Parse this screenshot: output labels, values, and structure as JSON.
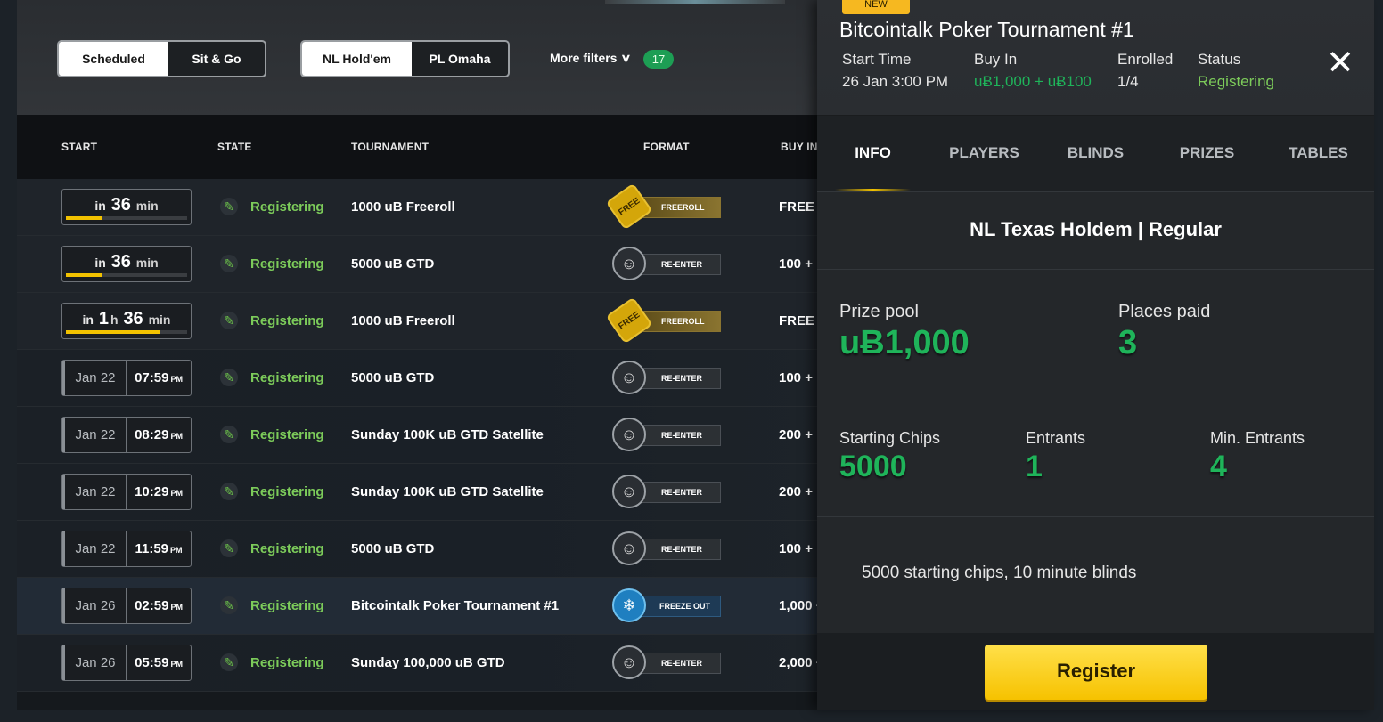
{
  "lobby": {
    "tabs_type": [
      "Scheduled",
      "Sit & Go"
    ],
    "tabs_game": [
      "NL Hold'em",
      "PL Omaha"
    ],
    "more_filters": "More filters",
    "filter_count": "17",
    "columns": {
      "start": "START",
      "state": "STATE",
      "tournament": "TOURNAMENT",
      "format": "FORMAT",
      "buyin": "BUY IN"
    },
    "rows": [
      {
        "kind": "countdown",
        "prefix": "in",
        "h": "",
        "h_unit": "",
        "m": "36",
        "m_unit": "min",
        "progress": 0.3,
        "state": "Registering",
        "name": "1000 uB Freeroll",
        "format": "FREEROLL",
        "format_icon": "free-tag-icon",
        "buyin": "FREE"
      },
      {
        "kind": "countdown",
        "prefix": "in",
        "h": "",
        "h_unit": "",
        "m": "36",
        "m_unit": "min",
        "progress": 0.3,
        "state": "Registering",
        "name": "5000 uB GTD",
        "format": "RE-ENTER",
        "format_icon": "re-enter-icon",
        "buyin": "100 +"
      },
      {
        "kind": "countdown",
        "prefix": "in",
        "h": "1",
        "h_unit": "h",
        "m": "36",
        "m_unit": "min",
        "progress": 0.78,
        "state": "Registering",
        "name": "1000 uB Freeroll",
        "format": "FREEROLL",
        "format_icon": "free-tag-icon",
        "buyin": "FREE"
      },
      {
        "kind": "date",
        "date": "Jan 22",
        "time": "07:59",
        "ampm": "PM",
        "state": "Registering",
        "name": "5000 uB GTD",
        "format": "RE-ENTER",
        "format_icon": "re-enter-icon",
        "buyin": "100 +"
      },
      {
        "kind": "date",
        "date": "Jan 22",
        "time": "08:29",
        "ampm": "PM",
        "state": "Registering",
        "name": "Sunday 100K uB GTD Satellite",
        "format": "RE-ENTER",
        "format_icon": "re-enter-icon",
        "buyin": "200 +"
      },
      {
        "kind": "date",
        "date": "Jan 22",
        "time": "10:29",
        "ampm": "PM",
        "state": "Registering",
        "name": "Sunday 100K uB GTD Satellite",
        "format": "RE-ENTER",
        "format_icon": "re-enter-icon",
        "buyin": "200 +"
      },
      {
        "kind": "date",
        "date": "Jan 22",
        "time": "11:59",
        "ampm": "PM",
        "state": "Registering",
        "name": "5000 uB GTD",
        "format": "RE-ENTER",
        "format_icon": "re-enter-icon",
        "buyin": "100 +"
      },
      {
        "kind": "date",
        "date": "Jan 26",
        "time": "02:59",
        "ampm": "PM",
        "state": "Registering",
        "name": "Bitcointalk Poker Tournament #1",
        "format": "FREEZE OUT",
        "format_icon": "snowflake-icon",
        "buyin": "1,000 +",
        "highlight": true
      },
      {
        "kind": "date",
        "date": "Jan 26",
        "time": "05:59",
        "ampm": "PM",
        "state": "Registering",
        "name": "Sunday 100,000 uB GTD",
        "format": "RE-ENTER",
        "format_icon": "re-enter-icon",
        "buyin": "2,000 +"
      }
    ]
  },
  "detail": {
    "badge": "NEW",
    "title": "Bitcointalk Poker Tournament #1",
    "start_label": "Start Time",
    "start_value": "26 Jan 3:00 PM",
    "buyin_label": "Buy In",
    "buyin_value": "uɃ1,000 + uɃ100",
    "enrolled_label": "Enrolled",
    "enrolled_value": "1/4",
    "status_label": "Status",
    "status_value": "Registering",
    "close_icon": "close-icon",
    "tabs": [
      "INFO",
      "PLAYERS",
      "BLINDS",
      "PRIZES",
      "TABLES"
    ],
    "game_type": "NL Texas Holdem | Regular",
    "prize_pool_label": "Prize pool",
    "prize_pool_value": "uɃ1,000",
    "places_paid_label": "Places paid",
    "places_paid_value": "3",
    "starting_chips_label": "Starting Chips",
    "starting_chips_value": "5000",
    "entrants_label": "Entrants",
    "entrants_value": "1",
    "min_entrants_label": "Min. Entrants",
    "min_entrants_value": "4",
    "description": "5000 starting chips, 10 minute blinds",
    "register": "Register"
  },
  "colors": {
    "accent_yellow": "#f6c200",
    "green": "#1fb45a",
    "state_green": "#7ccb5a"
  }
}
